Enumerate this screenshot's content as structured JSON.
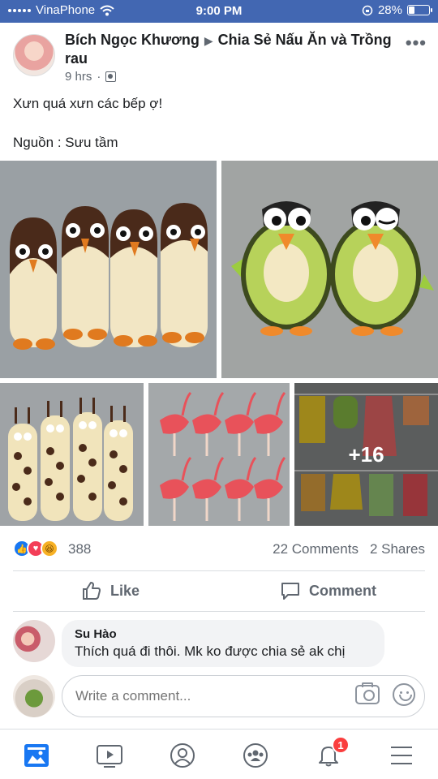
{
  "status_bar": {
    "carrier": "VinaPhone",
    "time": "9:00 PM",
    "battery": "28%",
    "battery_level": 0.28
  },
  "post": {
    "author": "Bích Ngọc Khương",
    "group": "Chia Sẻ Nấu Ăn và Trồng rau",
    "time": "9 hrs",
    "text_line1": "Xưn quá xưn các bếp ợ!",
    "text_line2": "Nguồn : Sưu tầm",
    "more_photos": "+16"
  },
  "reactions": {
    "count": "388",
    "comments": "22 Comments",
    "shares": "2 Shares"
  },
  "actions": {
    "like": "Like",
    "comment": "Comment"
  },
  "comment": {
    "name": "Su Hào",
    "text": "Thích quá đi thôi. Mk ko được chia sẻ ak chị"
  },
  "write_comment": {
    "placeholder": "Write a comment..."
  },
  "nav": {
    "notification_count": "1"
  },
  "icons": [
    "wifi-icon",
    "lock-rotation-icon",
    "battery-icon",
    "more-icon",
    "audience-icon",
    "like-reaction-icon",
    "love-reaction-icon",
    "haha-reaction-icon",
    "thumbs-up-icon",
    "comment-icon",
    "camera-icon",
    "smile-icon",
    "news-feed-icon",
    "watch-icon",
    "profile-icon",
    "groups-icon",
    "bell-icon",
    "menu-icon"
  ],
  "colors": {
    "brand": "#4267b2",
    "active_nav": "#1877f2",
    "badge": "#fa3e3e"
  }
}
